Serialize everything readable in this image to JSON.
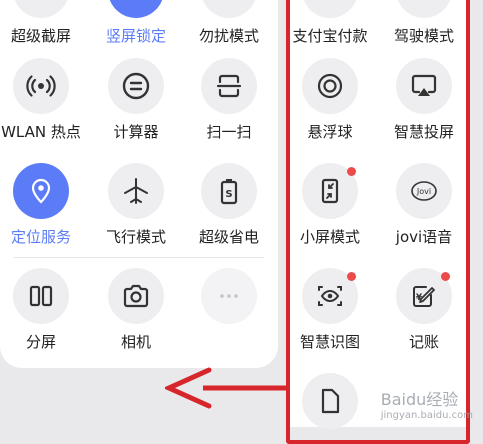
{
  "left_panel": {
    "row1": {
      "screenshot_label": "超级截屏",
      "portrait_lock_label": "竖屏锁定",
      "dnd_label": "勿扰模式"
    },
    "row2": {
      "wlan_hotspot_label": "WLAN 热点",
      "calculator_label": "计算器",
      "scan_label": "扫一扫"
    },
    "row3": {
      "location_label": "定位服务",
      "airplane_label": "飞行模式",
      "power_saving_label": "超级省电"
    },
    "row4": {
      "split_screen_label": "分屏",
      "camera_label": "相机"
    }
  },
  "right_panel": {
    "alipay_label": "支付宝付款",
    "driving_mode_label": "驾驶模式",
    "floating_ball_label": "悬浮球",
    "smart_cast_label": "智慧投屏",
    "small_screen_label": "小屏模式",
    "jovi_voice_label": "jovi语音",
    "smart_recognition_label": "智慧识图",
    "bookkeeping_label": "记账",
    "jovi_icon_text": "Jovi",
    "bookkeeping_icon_text": "¥"
  },
  "watermark": {
    "brand": "Baidu经验",
    "sub": "jingyan.baidu.com"
  },
  "colors": {
    "accent": "#5b7cf6",
    "annotation_red": "#d7262b",
    "badge_red": "#ee4a4a"
  }
}
